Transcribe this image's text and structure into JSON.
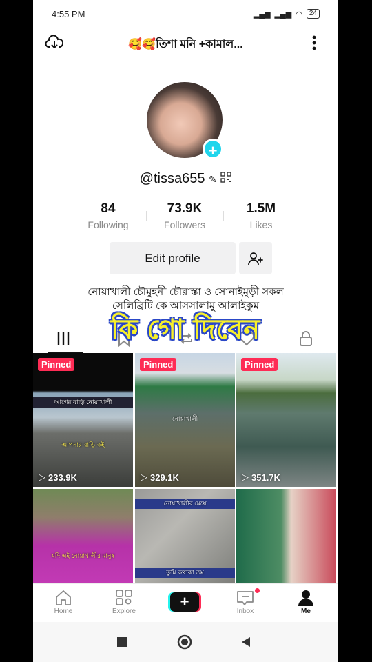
{
  "status_bar": {
    "time": "4:55 PM",
    "battery": "24"
  },
  "header": {
    "title": "🥰🥰তিশা মনি +কামাল..."
  },
  "profile": {
    "username": "@tissa655",
    "stats": [
      {
        "value": "84",
        "label": "Following"
      },
      {
        "value": "73.9K",
        "label": "Followers"
      },
      {
        "value": "1.5M",
        "label": "Likes"
      }
    ],
    "edit_profile_label": "Edit profile",
    "bio_line1": "নোয়াখালী চৌমুহনী চৌরাস্তা ও সোনাইমুড়ী সকল",
    "bio_line2": "সেলিব্রিটি কে আসসালামু আলাইকুম",
    "overlay_caption": "কি গো দিবেন"
  },
  "videos": [
    {
      "pinned": "Pinned",
      "views": "233.9K",
      "cap1": "আগের বাড়ি নোয়াখালী",
      "cap2": "আপনার বাড়ি কই"
    },
    {
      "pinned": "Pinned",
      "views": "329.1K",
      "cap1": "নোয়াখালী"
    },
    {
      "pinned": "Pinned",
      "views": "351.7K"
    },
    {
      "cap1": "যদি এই নোয়াখালীর মানুষ"
    },
    {
      "cap1": "নোয়াখালীর মেয়ে",
      "cap2": "তুমি কথাকা তম"
    },
    {}
  ],
  "bottom_nav": {
    "home": "Home",
    "explore": "Explore",
    "inbox": "Inbox",
    "me": "Me"
  },
  "colors": {
    "accent": "#fe2c55",
    "cyan": "#20d5ec"
  }
}
